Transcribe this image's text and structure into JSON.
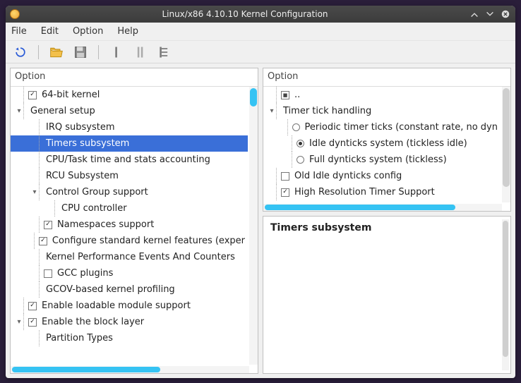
{
  "window": {
    "title": "Linux/x86 4.10.10 Kernel Configuration"
  },
  "menubar": [
    "File",
    "Edit",
    "Option",
    "Help"
  ],
  "panes": {
    "left_header": "Option",
    "right_header": "Option"
  },
  "left_tree": [
    {
      "indent": 0,
      "expander": "",
      "check": "checked",
      "label": "64-bit kernel"
    },
    {
      "indent": 0,
      "expander": "v",
      "check": "none",
      "label": "General setup"
    },
    {
      "indent": 1,
      "expander": "",
      "check": "none",
      "label": "IRQ subsystem"
    },
    {
      "indent": 1,
      "expander": "",
      "check": "none",
      "label": "Timers subsystem",
      "selected": true
    },
    {
      "indent": 1,
      "expander": "",
      "check": "none",
      "label": "CPU/Task time and stats accounting"
    },
    {
      "indent": 1,
      "expander": "",
      "check": "none",
      "label": "RCU Subsystem"
    },
    {
      "indent": 1,
      "expander": "v",
      "check": "none",
      "label": "Control Group support"
    },
    {
      "indent": 2,
      "expander": "",
      "check": "none",
      "label": "CPU controller"
    },
    {
      "indent": 1,
      "expander": "",
      "check": "checked",
      "label": "Namespaces support"
    },
    {
      "indent": 1,
      "expander": "",
      "check": "checked",
      "label": "Configure standard kernel features (exper"
    },
    {
      "indent": 1,
      "expander": "",
      "check": "none",
      "label": "Kernel Performance Events And Counters"
    },
    {
      "indent": 1,
      "expander": "",
      "check": "empty",
      "label": "GCC plugins"
    },
    {
      "indent": 1,
      "expander": "",
      "check": "none",
      "label": "GCOV-based kernel profiling"
    },
    {
      "indent": 0,
      "expander": "",
      "check": "checked",
      "label": "Enable loadable module support"
    },
    {
      "indent": 0,
      "expander": "v",
      "check": "checked",
      "label": "Enable the block layer"
    },
    {
      "indent": 1,
      "expander": "",
      "check": "none",
      "label": "Partition Types"
    }
  ],
  "right_tree": [
    {
      "indent": 0,
      "expander": "",
      "check": "box",
      "label": ".."
    },
    {
      "indent": 0,
      "expander": "v",
      "check": "none",
      "label": "Timer tick handling"
    },
    {
      "indent": 1,
      "expander": "",
      "radio": "off",
      "label": "Periodic timer ticks (constant rate, no dyn"
    },
    {
      "indent": 1,
      "expander": "",
      "radio": "on",
      "label": "Idle dynticks system (tickless idle)"
    },
    {
      "indent": 1,
      "expander": "",
      "radio": "off",
      "label": "Full dynticks system (tickless)"
    },
    {
      "indent": 0,
      "expander": "",
      "check": "empty",
      "label": "Old Idle dynticks config"
    },
    {
      "indent": 0,
      "expander": "",
      "check": "checked",
      "label": "High Resolution Timer Support"
    }
  ],
  "info": {
    "title": "Timers subsystem"
  }
}
